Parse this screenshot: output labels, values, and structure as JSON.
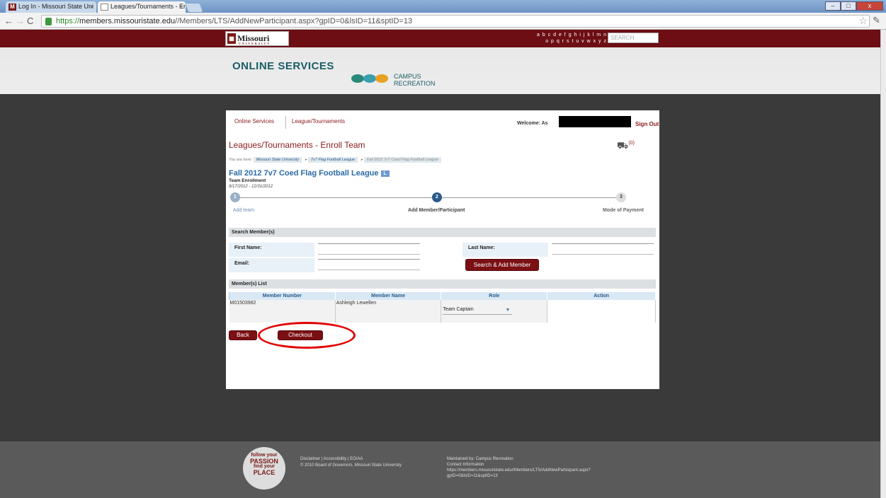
{
  "browser": {
    "tabs": [
      {
        "icon": "M",
        "label": "Log In - Missouri State Uni",
        "close": "×"
      },
      {
        "icon": "",
        "label": "Leagues/Tournaments - Er",
        "close": "×"
      }
    ],
    "window_buttons": {
      "minimize": "–",
      "maximize": "□",
      "close": "x"
    },
    "url": {
      "scheme": "https://",
      "domain": "members.missouristate.edu",
      "path": "//Members/LTS/AddNewParticipant.aspx?gpID=0&lsID=11&sptID=13"
    }
  },
  "site": {
    "logo": "Missouri State.",
    "logo_sub": "UNIVERSITY",
    "alphabet_row1": "a b c d e f g h i j k l m n",
    "alphabet_row2": "o p q r s t u v w x y z",
    "search_placeholder": "SEARCH",
    "online_services": "ONLINE SERVICES",
    "campus_rec_line1": "CAMPUS",
    "campus_rec_line2": "RECREATION"
  },
  "page": {
    "crumb_online": "Online Services",
    "crumb_league": "League/Tournaments",
    "welcome": "Welcome: As",
    "sign_out": "Sign Out",
    "title": "Leagues/Tournaments - Enroll Team",
    "cart_count": "(0)",
    "you_are_here": "You are here:",
    "breadcrumbs": [
      "Missouri State University",
      "7v7 Flag Football League",
      "Fall 2012 7v7 Coed Flag Football League"
    ],
    "breadcrumb_sep": "▸",
    "league_title": "Fall 2012 7v7 Coed Flag Football League",
    "league_icon": "L",
    "team_enrollment": "Team Enrollment",
    "date_range": "9/17/2012 - 12/31/2012",
    "steps": [
      {
        "num": "1",
        "label": "Add team"
      },
      {
        "num": "2",
        "label": "Add Member/Participant"
      },
      {
        "num": "3",
        "label": "Mode of Payment"
      }
    ],
    "search_section": "Search Member(s)",
    "first_name_label": "First Name:",
    "last_name_label": "Last Name:",
    "email_label": "Email:",
    "search_add_button": "Search & Add Member",
    "members_section": "Member(s) List",
    "table_headers": [
      "Member Number",
      "Member Name",
      "Role",
      "Action"
    ],
    "rows": [
      {
        "number": "M01503982",
        "name": "Ashleigh Lewellen",
        "role": "Team Captain",
        "action": ""
      }
    ],
    "back_button": "Back",
    "checkout_button": "Checkout"
  },
  "footer": {
    "badge_line1": "follow your",
    "badge_line2": "PASSION",
    "badge_line3": "find your",
    "badge_line4": "PLACE",
    "links": "Disclaimer  |  Accessibility  |  EO/AA",
    "copyright": "© 2010 Board of Governors, Missouri State University",
    "maintained": "Maintained by: Campus Recreation",
    "contact": "Contact Information",
    "page_url": "https://members.missouristate.edu//Members/LTS/AddNewParticipant.aspx?gpID=0&lsID=11&sptID=13"
  }
}
